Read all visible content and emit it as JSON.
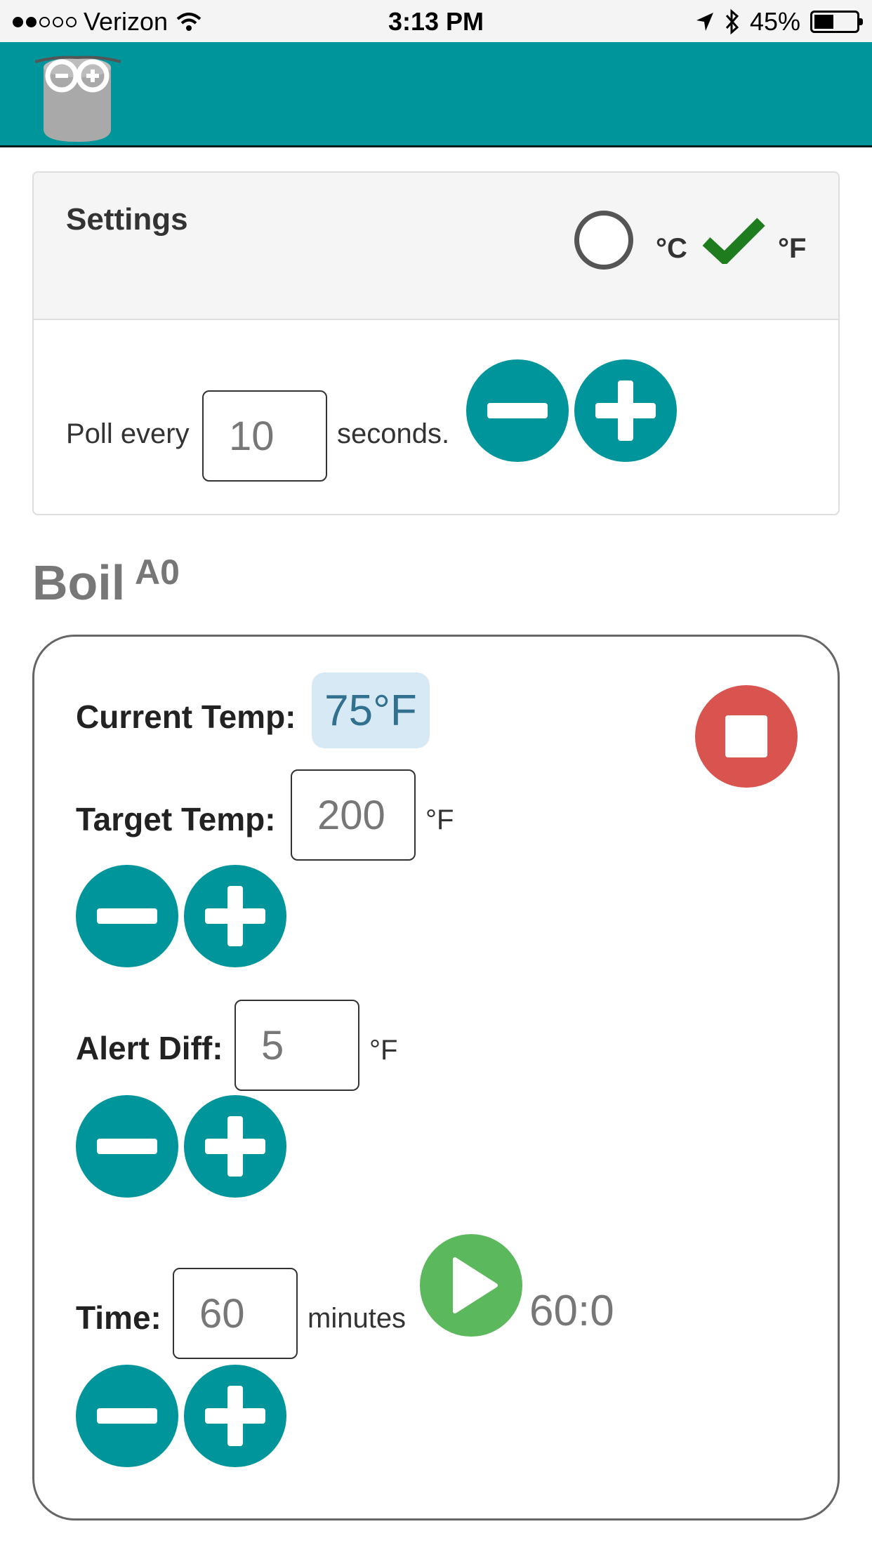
{
  "status_bar": {
    "carrier": "Verizon",
    "time": "3:13 PM",
    "battery": "45%",
    "battery_level": 0.45
  },
  "header": {
    "logo_icon": "arduino-can-logo-icon"
  },
  "settings": {
    "title": "Settings",
    "unit_celsius": "°C",
    "unit_fahrenheit": "°F",
    "selected_unit": "°F",
    "poll_label": "Poll every",
    "poll_value": "10",
    "poll_unit": "seconds."
  },
  "boil": {
    "title": "Boil",
    "pin": "A0",
    "current_temp_label": "Current Temp:",
    "current_temp": "75°F",
    "target_temp_label": "Target Temp:",
    "target_temp_value": "200",
    "target_temp_unit": "°F",
    "alert_diff_label": "Alert Diff:",
    "alert_diff_value": "5",
    "alert_diff_unit": "°F",
    "time_label": "Time:",
    "time_value": "60",
    "time_unit": "minutes",
    "timer_display": "60:0"
  },
  "colors": {
    "teal": "#00959a",
    "stop_red": "#d9534f",
    "play_green": "#5cb85c",
    "badge_bg": "#d6e9f5"
  }
}
